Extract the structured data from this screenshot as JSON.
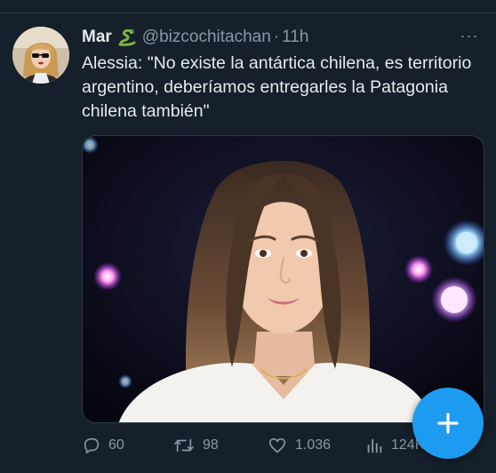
{
  "tweet": {
    "author_name": "Mar",
    "author_emoji": "snake-emoji",
    "handle": "@bizcochitachan",
    "separator": "·",
    "time": "11h",
    "more_label": "···",
    "text": "Alessia: \"No existe la antártica chilena, es territorio argentino, deberíamos entregarles la Patagonia chilena también\"",
    "media_description": "video-thumbnail-woman-dark-background"
  },
  "actions": {
    "replies": "60",
    "retweets": "98",
    "likes": "1.036",
    "views": "124K"
  },
  "fab": {
    "label": "+"
  },
  "colors": {
    "background": "#15202b",
    "accent": "#1d9bf0",
    "muted_text": "#8b98a5",
    "primary_text": "#e7e9ea"
  }
}
